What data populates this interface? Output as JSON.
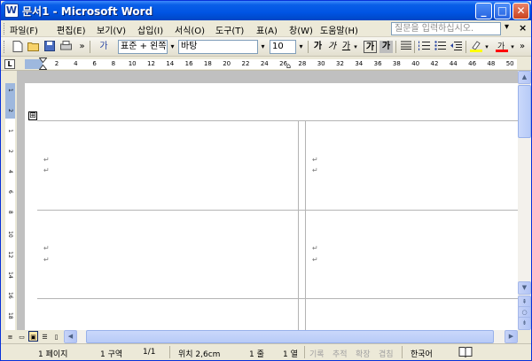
{
  "window": {
    "title": "문서1 - Microsoft Word",
    "app_icon": "W",
    "minimize": "_",
    "maximize": "□",
    "close": "✕"
  },
  "menu": {
    "items": [
      "파일(F)",
      "편집(E)",
      "보기(V)",
      "삽입(I)",
      "서식(O)",
      "도구(T)",
      "표(A)",
      "창(W)",
      "도움말(H)"
    ],
    "ask_placeholder": "질문을 입력하십시오.",
    "ask_arrow": "▾",
    "close_doc": "×"
  },
  "toolbar": {
    "style_prefix": "가",
    "style": "표준 + 왼쪽",
    "font": "바탕",
    "size": "10",
    "combo_arrow": "▾",
    "bold_label": "가",
    "italic_label": "가",
    "underline_label": "가"
  },
  "ruler": {
    "corner": "L",
    "numbers": [
      "2",
      "4",
      "6",
      "8",
      "10",
      "12",
      "14",
      "16",
      "18",
      "20",
      "22",
      "24",
      "26",
      "28",
      "30",
      "32",
      "34",
      "36",
      "38",
      "40",
      "42",
      "44",
      "46",
      "48",
      "50"
    ]
  },
  "vruler": {
    "numbers": [
      "1",
      "2",
      "1",
      "2",
      "4",
      "6",
      "8",
      "10",
      "12",
      "14",
      "16",
      "18"
    ]
  },
  "document": {
    "para_mark": "↵",
    "table_handle": "⊞"
  },
  "scroll": {
    "up": "▲",
    "down": "▼",
    "prev_page": "⇞",
    "select_browse": "○",
    "next_page": "⇟",
    "left": "◀",
    "right": "▶"
  },
  "status": {
    "page": "1 페이지",
    "section": "1 구역",
    "page_of": "1/1",
    "position": "위치 2,6cm",
    "line": "1 줄",
    "column": "1 열",
    "rec": "기록",
    "trk": "추적",
    "ext": "확장",
    "ovr": "겹침",
    "language": "한국어"
  }
}
